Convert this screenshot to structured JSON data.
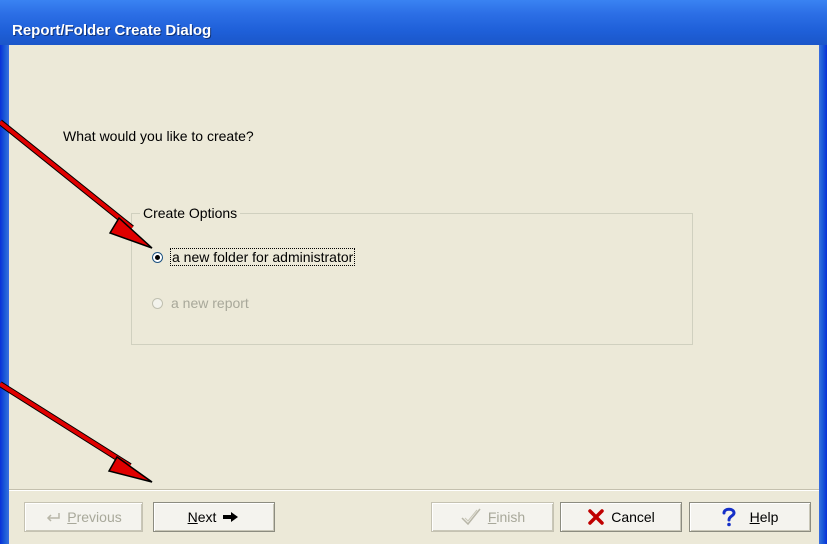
{
  "window": {
    "title": "Report/Folder Create Dialog"
  },
  "content": {
    "prompt": "What would you like to create?",
    "group_label": "Create Options",
    "options": [
      {
        "label": "a new folder for administrator",
        "selected": true,
        "enabled": true
      },
      {
        "label": "a new report",
        "selected": false,
        "enabled": false
      }
    ]
  },
  "buttons": {
    "previous": {
      "mnemonic": "P",
      "rest": "revious",
      "enabled": false,
      "icon": "back-arrow-icon"
    },
    "next": {
      "label": "Next",
      "mnemonic": "N",
      "rest": "ext",
      "enabled": true,
      "icon": "right-arrow-icon"
    },
    "finish": {
      "mnemonic": "F",
      "rest": "inish",
      "enabled": false,
      "icon": "finish-check-icon"
    },
    "cancel": {
      "label": "Cancel",
      "enabled": true,
      "icon": "red-x-icon"
    },
    "help": {
      "mnemonic": "H",
      "rest": "elp",
      "enabled": true,
      "icon": "question-mark-icon"
    }
  },
  "annotations": {
    "arrow_color": "#E00000",
    "arrow_count": 2
  },
  "colors": {
    "title_bar": "#1E5FD8",
    "dialog_background": "#ECE9D8",
    "disabled_text": "#A8A89A"
  }
}
